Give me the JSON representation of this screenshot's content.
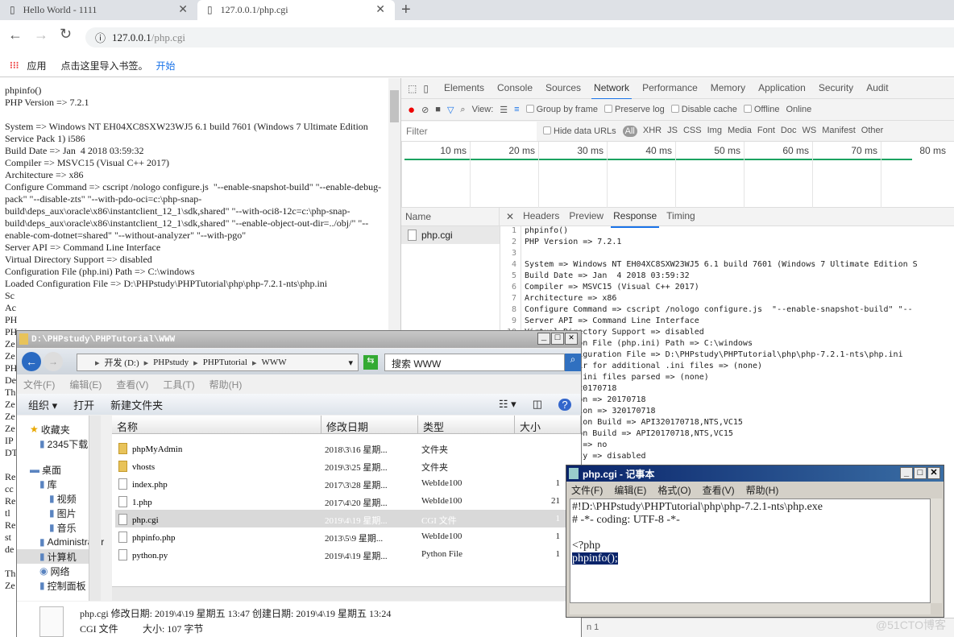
{
  "browser": {
    "tabs": [
      {
        "title": "Hello World - 1111",
        "active": false
      },
      {
        "title": "127.0.0.1/php.cgi",
        "active": true
      }
    ],
    "url_host": "127.0.0.1",
    "url_path": "/php.cgi",
    "bookmarks": {
      "apps": "应用",
      "import": "点击这里导入书签。",
      "start": "开始"
    }
  },
  "page_lines": [
    "phpinfo()",
    "PHP Version => 7.2.1",
    "",
    "System => Windows NT EH04XC8SXW23WJ5 6.1 build 7601 (Windows 7 Ultimate Edition Service Pack 1) i586",
    "Build Date => Jan  4 2018 03:59:32",
    "Compiler => MSVC15 (Visual C++ 2017)",
    "Architecture => x86",
    "Configure Command => cscript /nologo configure.js  \"--enable-snapshot-build\" \"--enable-debug-pack\" \"--disable-zts\" \"--with-pdo-oci=c:\\php-snap-build\\deps_aux\\oracle\\x86\\instantclient_12_1\\sdk,shared\" \"--with-oci8-12c=c:\\php-snap-build\\deps_aux\\oracle\\x86\\instantclient_12_1\\sdk,shared\" \"--enable-object-out-dir=../obj/\" \"--enable-com-dotnet=shared\" \"--without-analyzer\" \"--with-pgo\"",
    "Server API => Command Line Interface",
    "Virtual Directory Support => disabled",
    "Configuration File (php.ini) Path => C:\\windows",
    "Loaded Configuration File => D:\\PHPstudy\\PHPTutorial\\php\\php-7.2.1-nts\\php.ini",
    "Sc",
    "Ac",
    "PH",
    "PH",
    "Ze",
    "Ze",
    "PH",
    "De",
    "Th",
    "Ze",
    "Ze",
    "Ze",
    "IP",
    "DT",
    "",
    "Re",
    "cc",
    "Re",
    "tl",
    "Re",
    "st",
    "de",
    "",
    "Th",
    "Ze"
  ],
  "devtools": {
    "tabs": [
      "Elements",
      "Console",
      "Sources",
      "Network",
      "Performance",
      "Memory",
      "Application",
      "Security",
      "Audit"
    ],
    "active_tab": "Network",
    "toolbar": {
      "view": "View:",
      "group": "Group by frame",
      "preserve": "Preserve log",
      "disable_cache": "Disable cache",
      "offline": "Offline",
      "online": "Online"
    },
    "filter_placeholder": "Filter",
    "hide_data": "Hide data URLs",
    "types": [
      "All",
      "XHR",
      "JS",
      "CSS",
      "Img",
      "Media",
      "Font",
      "Doc",
      "WS",
      "Manifest",
      "Other"
    ],
    "ticks": [
      "10 ms",
      "20 ms",
      "30 ms",
      "40 ms",
      "50 ms",
      "60 ms",
      "70 ms",
      "80 ms"
    ],
    "name_header": "Name",
    "request": "php.cgi",
    "panel_tabs": [
      "Headers",
      "Preview",
      "Response",
      "Timing"
    ],
    "active_panel": "Response",
    "response_lines": [
      "phpinfo()",
      "PHP Version => 7.2.1",
      "",
      "System => Windows NT EH04XC8SXW23WJ5 6.1 build 7601 (Windows 7 Ultimate Edition S",
      "Build Date => Jan  4 2018 03:59:32",
      "Compiler => MSVC15 (Visual C++ 2017)",
      "Architecture => x86",
      "Configure Command => cscript /nologo configure.js  \"--enable-snapshot-build\" \"--",
      "Server API => Command Line Interface",
      "Virtual Directory Support => disabled",
      "Configuration File (php.ini) Path => C:\\windows",
      "Loaded Configuration File => D:\\PHPstudy\\PHPTutorial\\php\\php-7.2.1-nts\\php.ini",
      "Scan this dir for additional .ini files => (none)",
      "Additional .ini files parsed => (none)",
      "PHP API => 20170718",
      "PHP Extension => 20170718",
      "Zend Extension => 320170718",
      "Zend Extension Build => API320170718,NTS,VC15",
      "PHP Extension Build => API20170718,NTS,VC15",
      "Debug Build => no",
      "Thread Safety => disabled"
    ],
    "status": "n 1"
  },
  "explorer": {
    "title": "D:\\PHPstudy\\PHPTutorial\\WWW",
    "crumbs": [
      "开发 (D:)",
      "PHPstudy",
      "PHPTutorial",
      "WWW"
    ],
    "search": "搜索 WWW",
    "menu": [
      "文件(F)",
      "编辑(E)",
      "查看(V)",
      "工具(T)",
      "帮助(H)"
    ],
    "toolbar": [
      "组织 ▾",
      "打开",
      "新建文件夹"
    ],
    "nav": [
      "收藏夹",
      "2345下载",
      "桌面",
      "库",
      "视频",
      "图片",
      "音乐",
      "Administrator",
      "计算机",
      "网络",
      "控制面板"
    ],
    "columns": [
      "名称",
      "修改日期",
      "类型",
      "大小"
    ],
    "files": [
      {
        "name": "phpMyAdmin",
        "date": "2018\\3\\16 星期...",
        "type": "文件夹",
        "size": "",
        "folder": true
      },
      {
        "name": "vhosts",
        "date": "2019\\3\\25 星期...",
        "type": "文件夹",
        "size": "",
        "folder": true
      },
      {
        "name": "index.php",
        "date": "2017\\3\\28 星期...",
        "type": "WebIde100",
        "size": "1"
      },
      {
        "name": "1.php",
        "date": "2017\\4\\20 星期...",
        "type": "WebIde100",
        "size": "21"
      },
      {
        "name": "php.cgi",
        "date": "2019\\4\\19 星期...",
        "type": "CGI 文件",
        "size": "1",
        "selected": true
      },
      {
        "name": "phpinfo.php",
        "date": "2013\\5\\9 星期...",
        "type": "WebIde100",
        "size": "1"
      },
      {
        "name": "python.py",
        "date": "2019\\4\\19 星期...",
        "type": "Python File",
        "size": "1"
      }
    ],
    "details": {
      "line1": "php.cgi 修改日期: 2019\\4\\19 星期五 13:47 创建日期: 2019\\4\\19 星期五 13:24",
      "type": "CGI 文件",
      "size": "大小: 107 字节"
    }
  },
  "notepad": {
    "title": "php.cgi - 记事本",
    "menu": [
      "文件(F)",
      "编辑(E)",
      "格式(O)",
      "查看(V)",
      "帮助(H)"
    ],
    "lines": [
      "#!D:\\PHPstudy\\PHPTutorial\\php\\php-7.2.1-nts\\php.exe",
      "# -*- coding: UTF-8 -*-",
      "",
      "<?php"
    ],
    "selected_line": "phpinfo();"
  },
  "watermark": "@51CTO博客"
}
